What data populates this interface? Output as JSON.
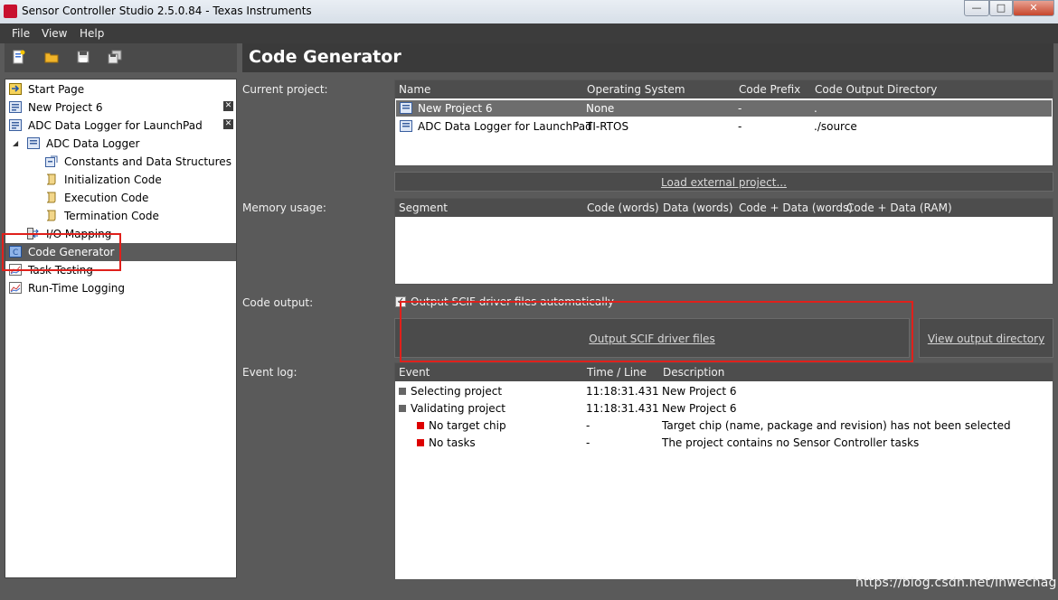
{
  "window": {
    "title": "Sensor Controller Studio 2.5.0.84 - Texas Instruments",
    "min": "—",
    "max": "□",
    "close": "✕"
  },
  "menu": [
    "File",
    "View",
    "Help"
  ],
  "toolbar": [
    "new-project-icon",
    "open-folder-icon",
    "save-icon",
    "save-all-icon"
  ],
  "tree": {
    "items": [
      {
        "label": "Start Page",
        "icon": "start-page-icon"
      },
      {
        "label": "New Project 6",
        "icon": "project-icon",
        "closable": true
      },
      {
        "label": "ADC Data Logger for LaunchPad",
        "icon": "project-icon",
        "closable": true
      },
      {
        "label": "ADC Data Logger",
        "icon": "task-icon",
        "expander": "◢"
      },
      {
        "label": "Constants and Data Structures",
        "icon": "constants-icon"
      },
      {
        "label": "Initialization Code",
        "icon": "scroll-icon"
      },
      {
        "label": "Execution Code",
        "icon": "scroll-icon"
      },
      {
        "label": "Termination Code",
        "icon": "scroll-icon"
      },
      {
        "label": "I/O Mapping",
        "icon": "io-mapping-icon"
      },
      {
        "label": "Code Generator",
        "icon": "code-generator-icon",
        "selected": true
      },
      {
        "label": "Task Testing",
        "icon": "chart-icon"
      },
      {
        "label": "Run-Time Logging",
        "icon": "chart-icon"
      }
    ],
    "close_glyph": "✕"
  },
  "main": {
    "header": "Code Generator",
    "current_project": {
      "label": "Current project:",
      "columns": [
        "Name",
        "Operating System",
        "Code Prefix",
        "Code Output Directory"
      ],
      "rows": [
        {
          "name": "New Project 6",
          "os": "None",
          "prefix": "-",
          "dir": "."
        },
        {
          "name": "ADC Data Logger for LaunchPad",
          "os": "TI-RTOS",
          "prefix": "-",
          "dir": "./source"
        }
      ],
      "load_button": "Load external project..."
    },
    "memory": {
      "label": "Memory usage:",
      "columns": [
        "Segment",
        "Code  (words)",
        "Data  (words)",
        "Code + Data  (words)",
        "Code + Data  (RAM)"
      ]
    },
    "code_output": {
      "label": "Code output:",
      "checkbox_label": "Output SCIF driver files automatically",
      "check_glyph": "✓",
      "output_button": "Output SCIF driver files",
      "view_button": "View output directory"
    },
    "event_log": {
      "label": "Event log:",
      "columns": [
        "Event",
        "Time / Line",
        "Description"
      ],
      "rows": [
        {
          "event": "Selecting project",
          "time": "11:18:31.431",
          "desc": "New Project 6",
          "level": "info"
        },
        {
          "event": "Validating project",
          "time": "11:18:31.431",
          "desc": "New Project 6",
          "level": "info"
        },
        {
          "event": "No target chip",
          "time": "-",
          "desc": "Target chip (name, package and revision) has not been selected",
          "level": "error"
        },
        {
          "event": "No tasks",
          "time": "-",
          "desc": "The project contains no Sensor Controller tasks",
          "level": "error"
        }
      ]
    }
  },
  "colors": {
    "info": "#666666",
    "error": "#dd0000",
    "highlight": "#e0201b"
  },
  "watermark": "https://blog.csdn.net/inwechag"
}
